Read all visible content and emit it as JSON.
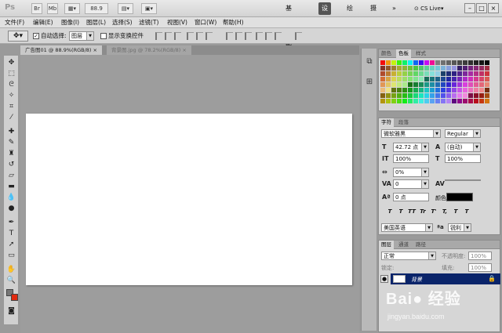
{
  "app": {
    "logo": "Ps",
    "zoom_value": "88.9",
    "workspaces": [
      "基本功能",
      "设计",
      "绘画",
      "摄影"
    ],
    "active_workspace": "设计",
    "more": "»",
    "cs_live": "CS Live▾",
    "window_controls": [
      "–",
      "□",
      "×"
    ]
  },
  "menu": [
    "文件(F)",
    "编辑(E)",
    "图像(I)",
    "图层(L)",
    "选择(S)",
    "滤镜(T)",
    "视图(V)",
    "窗口(W)",
    "帮助(H)"
  ],
  "options": {
    "auto_select_label": "自动选择:",
    "auto_select_checked": "✓",
    "auto_select_value": "图层",
    "transform_label": "显示变换控件"
  },
  "doc_tabs": [
    {
      "label": "广告图01 @ 88.9%(RGB/8)",
      "close": "×",
      "active": true
    },
    {
      "label": "背景图.jpg @ 78.2%(RGB/8)",
      "close": "×",
      "active": false
    }
  ],
  "swatches_panel": {
    "tabs": [
      "颜色",
      "色板",
      "样式"
    ],
    "active_tab": "色板"
  },
  "character_panel": {
    "tabs": [
      "字符",
      "段落"
    ],
    "active_tab": "字符",
    "font_family": "微软雅黑",
    "font_style": "Regular",
    "font_size": "42.72 点",
    "leading": "(自动)",
    "vertical_scale": "100%",
    "horizontal_scale": "100%",
    "tracking_percent": "0%",
    "kerning": "0",
    "baseline_shift": "0 点",
    "color_label": "颜色:",
    "color_value": "#000000",
    "style_buttons": [
      "T",
      "T",
      "TT",
      "Tr",
      "T'",
      "T,",
      "T",
      "T"
    ],
    "language": "美国英语",
    "aa_label": "ªa",
    "antialias": "锐利"
  },
  "layers_panel": {
    "tabs": [
      "图层",
      "通道",
      "路径"
    ],
    "active_tab": "图层",
    "blend_mode": "正常",
    "opacity_label": "不透明度:",
    "opacity_value": "100%",
    "lock_label": "锁定:",
    "fill_label": "填充:",
    "fill_value": "100%",
    "layer_name": "背景",
    "eye": "●"
  },
  "watermark": {
    "logo": "Bai● 经验",
    "url": "jingyan.baidu.com"
  }
}
